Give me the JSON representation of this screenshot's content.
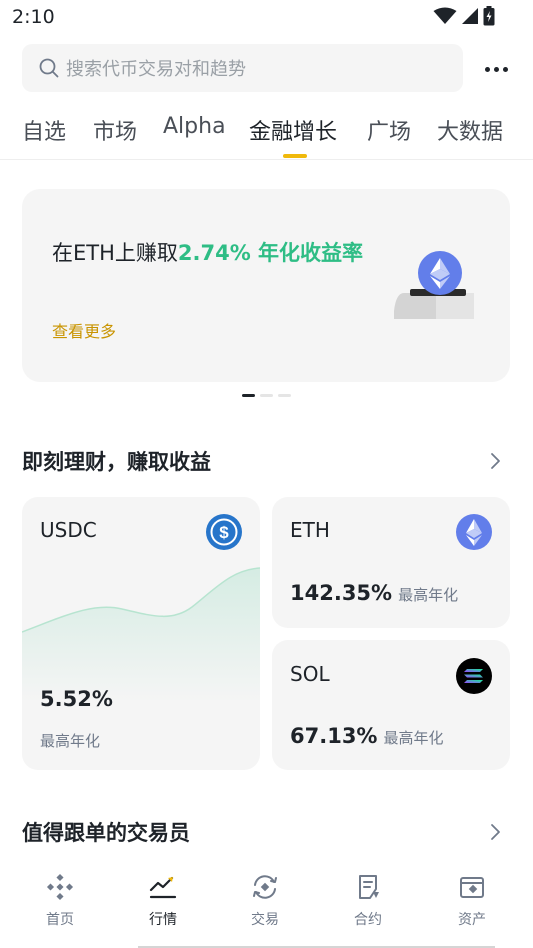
{
  "status_bar": {
    "time": "2:10"
  },
  "search": {
    "placeholder": "搜索代币交易对和趋势"
  },
  "tabs": [
    {
      "label": "自选"
    },
    {
      "label": "市场"
    },
    {
      "label": "Alpha"
    },
    {
      "label": "金融增长",
      "active": true
    },
    {
      "label": "广场"
    },
    {
      "label": "大数据"
    }
  ],
  "banner": {
    "title_prefix": "在ETH上赚取",
    "title_highlight": "2.74% 年化收益率",
    "link": "查看更多",
    "page_count": 3,
    "active_page": 1
  },
  "earn_section": {
    "title": "即刻理财，赚取收益",
    "products": [
      {
        "name": "USDC",
        "rate": "5.52%",
        "label": "最高年化"
      },
      {
        "name": "ETH",
        "rate": "142.35%",
        "label": "最高年化"
      },
      {
        "name": "SOL",
        "rate": "67.13%",
        "label": "最高年化"
      }
    ]
  },
  "traders_section": {
    "title": "值得跟单的交易员"
  },
  "bottom_nav": [
    {
      "label": "首页"
    },
    {
      "label": "行情",
      "active": true
    },
    {
      "label": "交易"
    },
    {
      "label": "合约"
    },
    {
      "label": "资产"
    }
  ],
  "colors": {
    "accent": "#f0b90b",
    "positive": "#2ebd85",
    "link": "#c99400",
    "usdc": "#2775ca",
    "eth": "#627eea"
  }
}
